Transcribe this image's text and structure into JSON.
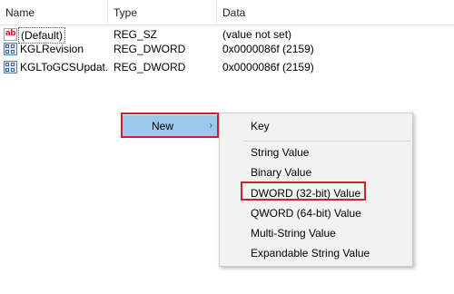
{
  "columns": {
    "name": "Name",
    "type": "Type",
    "data": "Data"
  },
  "rows": [
    {
      "icon": "string-value-icon",
      "name": "(Default)",
      "type": "REG_SZ",
      "data": "(value not set)"
    },
    {
      "icon": "dword-value-icon",
      "name": "KGLRevision",
      "type": "REG_DWORD",
      "data": "0x0000086f (2159)"
    },
    {
      "icon": "dword-value-icon",
      "name": "KGLToGCSUpdat...",
      "type": "REG_DWORD",
      "data": "0x0000086f (2159)"
    }
  ],
  "context_menu": {
    "new_label": "New",
    "submenu_arrow": "›",
    "submenu": [
      {
        "label": "Key"
      },
      {
        "label": "String Value"
      },
      {
        "label": "Binary Value"
      },
      {
        "label": "DWORD (32-bit) Value"
      },
      {
        "label": "QWORD (64-bit) Value"
      },
      {
        "label": "Multi-String Value"
      },
      {
        "label": "Expandable String Value"
      }
    ]
  },
  "colors": {
    "menu_hover": "#99c9ef",
    "annotation_red": "#d01f2f",
    "string_icon_text": "#c4281c"
  },
  "icons": {
    "string_value": "ab"
  }
}
